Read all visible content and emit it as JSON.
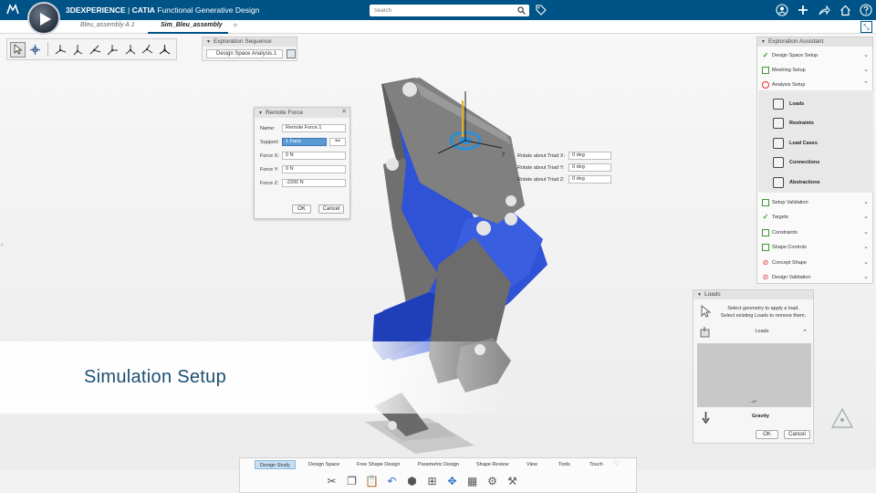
{
  "header": {
    "brand_3d": "3DEXPERIENCE",
    "separator": " | ",
    "brand_catia": "CATIA",
    "app_name": " Functional Generative Design",
    "search_placeholder": "Search"
  },
  "tabs": [
    {
      "label": "Bleu_assembly A.1",
      "active": false
    },
    {
      "label": "Sim_Bleu_assembly",
      "active": true
    }
  ],
  "tab_add": "+",
  "exploration_sequence": {
    "title": "Exploration Sequence",
    "selected": "Design Space Analysis.1"
  },
  "remote_force": {
    "title": "Remote Force",
    "name_label": "Name:",
    "name_value": "Remote Force.1",
    "support_label": "Support:",
    "support_value": "1 Face",
    "fx_label": "Force X:",
    "fx_value": "0 N",
    "fy_label": "Force Y:",
    "fy_value": "0 N",
    "fz_label": "Force Z:",
    "fz_value": "-2200 N",
    "ok": "OK",
    "cancel": "Cancel"
  },
  "rotate": {
    "x_label": "Rotate about Triad X:",
    "x_value": "0 deg",
    "y_label": "Rotate about Triad Y:",
    "y_value": "0 deg",
    "z_label": "Rotate about Triad Z:",
    "z_value": "0 deg"
  },
  "assistant": {
    "title": "Exploration Assistant",
    "items": [
      {
        "label": "Design Space Setup",
        "status": "check"
      },
      {
        "label": "Meshing Setup",
        "status": "box"
      },
      {
        "label": "Analysis Setup",
        "status": "circle"
      },
      {
        "label": "Setup Validation",
        "status": "box"
      },
      {
        "label": "Targets",
        "status": "check"
      },
      {
        "label": "Constraints",
        "status": "box"
      },
      {
        "label": "Shape Controls",
        "status": "box"
      },
      {
        "label": "Concept Shape",
        "status": "ban"
      },
      {
        "label": "Design Validation",
        "status": "ban"
      }
    ],
    "analysis_sub": [
      {
        "label": "Loads",
        "icon": "loads-icon"
      },
      {
        "label": "Restraints",
        "icon": "restraints-icon"
      },
      {
        "label": "Load Cases",
        "icon": "load-cases-icon"
      },
      {
        "label": "Connections",
        "icon": "connections-icon"
      },
      {
        "label": "Abstractions",
        "icon": "abstractions-icon"
      }
    ]
  },
  "loads_panel": {
    "title": "Loads",
    "message_line1": "Select geometry to apply a load.",
    "message_line2": "Select existing Loads to remove them.",
    "section": "Loads",
    "gravity": "Gravity",
    "ok": "OK",
    "cancel": "Cancel"
  },
  "banner": {
    "text": "Simulation Setup"
  },
  "model": {
    "triad_y_label": "y"
  },
  "action_bar": {
    "tabs": [
      "Design Study",
      "Design Space",
      "Free Shape Design",
      "Parametric Design",
      "Shape Review",
      "View",
      "Tools",
      "Touch"
    ],
    "active_tab": "Design Study"
  },
  "colors": {
    "header_bg": "#005386",
    "part_blue": "#2b4fd8",
    "part_gray": "#6e6e6e",
    "banner_text": "#1d4f73"
  }
}
